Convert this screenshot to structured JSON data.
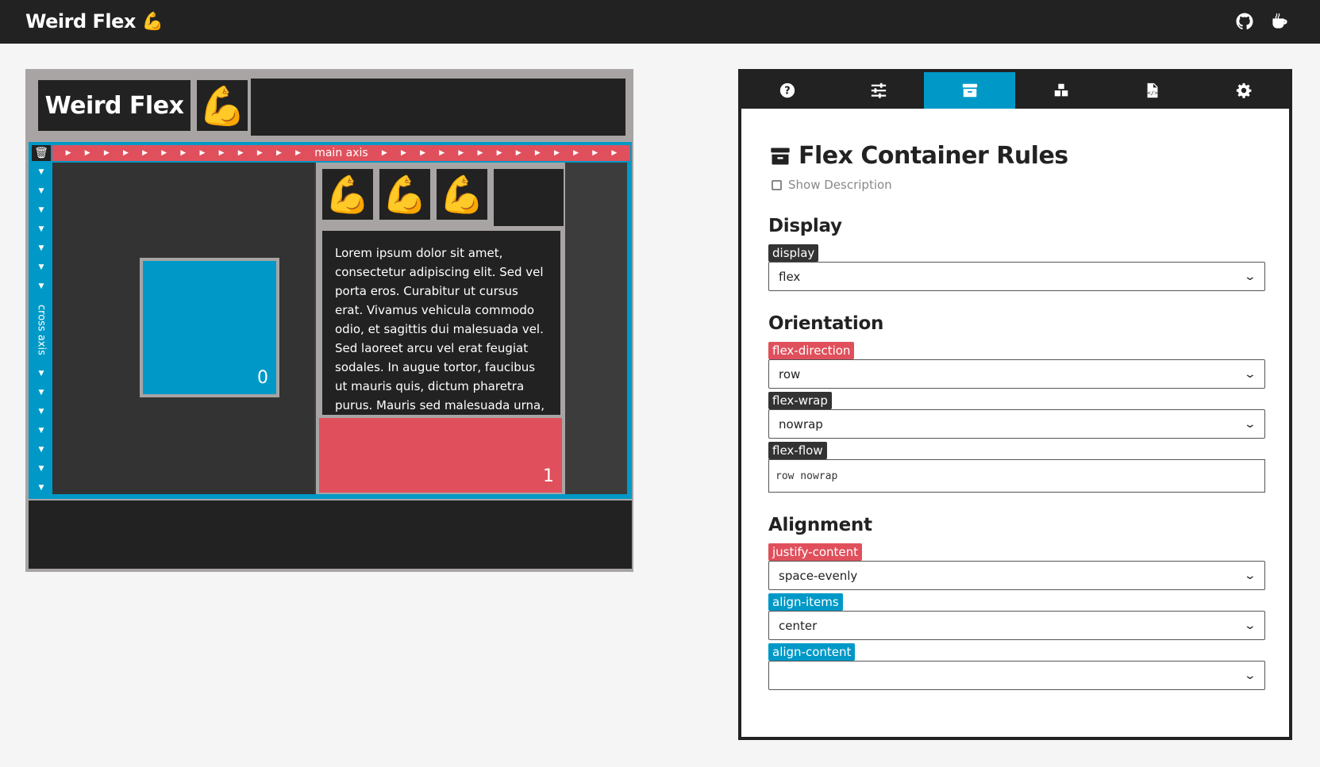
{
  "app": {
    "title": "Weird Flex",
    "emoji": "💪"
  },
  "topbar": {
    "icons": [
      "github-icon",
      "coffee-icon"
    ]
  },
  "playground": {
    "header_title": "Weird Flex",
    "header_emoji": "💪",
    "main_axis_label": "main axis",
    "cross_axis_label": "cross axis",
    "item0_number": "0",
    "item1_number": "1",
    "emojis": [
      "💪",
      "💪",
      "💪"
    ],
    "lorem": "Lorem ipsum dolor sit amet, consectetur adipiscing elit. Sed vel porta eros. Curabitur ut cursus erat. Vivamus vehicula commodo odio, et sagittis dui malesuada vel. Sed laoreet arcu vel erat feugiat sodales. In augue tortor, faucibus ut mauris quis, dictum pharetra purus. Mauris sed malesuada urna, eu accumsan ipsum."
  },
  "panel": {
    "tabs": [
      "help-icon",
      "sliders-icon",
      "archive-icon",
      "cubes-icon",
      "file-code-icon",
      "gear-icon"
    ],
    "active_tab": "archive-icon",
    "title": "Flex Container Rules",
    "show_description": "Show Description",
    "display": {
      "heading": "Display",
      "display_label": "display",
      "display_value": "flex"
    },
    "orientation": {
      "heading": "Orientation",
      "direction_label": "flex-direction",
      "direction_value": "row",
      "wrap_label": "flex-wrap",
      "wrap_value": "nowrap",
      "flow_label": "flex-flow",
      "flow_value": "row nowrap"
    },
    "alignment": {
      "heading": "Alignment",
      "justify_label": "justify-content",
      "justify_value": "space-evenly",
      "items_label": "align-items",
      "items_value": "center",
      "content_label": "align-content",
      "content_value": ""
    }
  },
  "colors": {
    "accent_blue": "#0099c7",
    "accent_red": "#e0505c",
    "dark": "#222222"
  }
}
